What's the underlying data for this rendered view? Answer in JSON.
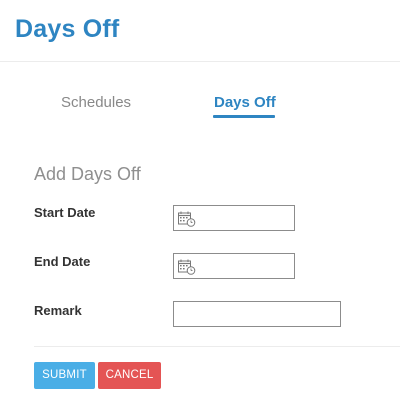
{
  "header": {
    "title": "Days Off"
  },
  "tabs": [
    {
      "label": "Schedules",
      "active": false
    },
    {
      "label": "Days Off",
      "active": true
    }
  ],
  "form": {
    "section_title": "Add Days Off",
    "fields": [
      {
        "label": "Start Date",
        "value": "",
        "icon": "calendar-clock-icon"
      },
      {
        "label": "End Date",
        "value": "",
        "icon": "calendar-clock-icon"
      },
      {
        "label": "Remark",
        "value": ""
      }
    ]
  },
  "buttons": {
    "submit_label": "SUBMIT",
    "cancel_label": "CANCEL"
  },
  "colors": {
    "accent": "#2e85c2",
    "submit": "#4aaee6",
    "cancel": "#e45454"
  }
}
